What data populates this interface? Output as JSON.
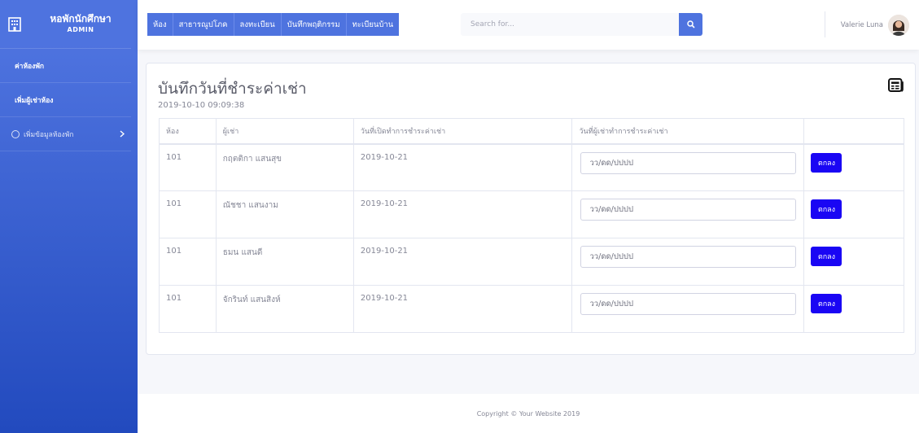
{
  "sidebar": {
    "brand_title": "หอพักนักศึกษา",
    "brand_sub": "ADMIN",
    "brand_icon": "building-icon",
    "items": [
      {
        "label": "ค่าห้องพัก"
      },
      {
        "label": "เพิ่มผู้เช่าห้อง"
      },
      {
        "label": "เพิ่มข้อมูลห้องพัก"
      }
    ]
  },
  "topbar": {
    "nav": [
      "ห้อง",
      "สาธารณูปโภค",
      "ลงทะเบียน",
      "บันทึกพฤติกรรม",
      "ทะเบียนบ้าน"
    ],
    "search_placeholder": "Search for...",
    "user_name": "Valerie Luna"
  },
  "main": {
    "title": "บันทึกวันที่ชำระค่าเช่า",
    "timestamp": "2019-10-10 09:09:38",
    "table": {
      "headers": [
        "ห้อง",
        "ผู้เช่า",
        "วันที่เปิดทำการชำระค่าเช่า",
        "วันที่ผู้เช่าทำการชำระค่าเช่า",
        ""
      ],
      "rows": [
        {
          "room": "101",
          "tenant": "กฤตติกา แสนสุข",
          "open_date": "2019-10-21",
          "date_placeholder": "วว/ดด/ปปปป",
          "button": "ตกลง"
        },
        {
          "room": "101",
          "tenant": "ณัชชา แสนงาม",
          "open_date": "2019-10-21",
          "date_placeholder": "วว/ดด/ปปปป",
          "button": "ตกลง"
        },
        {
          "room": "101",
          "tenant": "ธมน แสนดี",
          "open_date": "2019-10-21",
          "date_placeholder": "วว/ดด/ปปปป",
          "button": "ตกลง"
        },
        {
          "room": "101",
          "tenant": "จักรินท์ แสนสิงห์",
          "open_date": "2019-10-21",
          "date_placeholder": "วว/ดด/ปปปป",
          "button": "ตกลง"
        }
      ]
    }
  },
  "footer": {
    "text": "Copyright © Your Website 2019"
  },
  "colors": {
    "primary": "#4e73df",
    "button": "#1a06f4",
    "text": "#858796"
  }
}
